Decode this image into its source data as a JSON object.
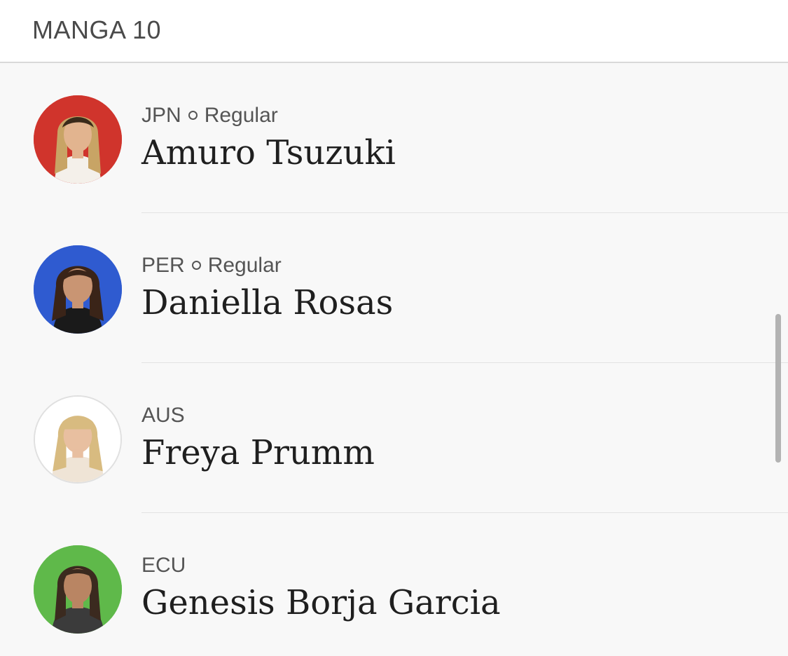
{
  "header": {
    "title": "MANGA 10"
  },
  "athletes": [
    {
      "country": "JPN",
      "stance": "Regular",
      "name": "Amuro Tsuzuki",
      "avatar_color": "#d0342c",
      "skin": "#e2b48f",
      "hair": "#c8a465"
    },
    {
      "country": "PER",
      "stance": "Regular",
      "name": "Daniella Rosas",
      "avatar_color": "#2f5bd0",
      "skin": "#c99573",
      "hair": "#3a2418"
    },
    {
      "country": "AUS",
      "stance": "",
      "name": "Freya Prumm",
      "avatar_color": "#ffffff",
      "skin": "#e8bfa0",
      "hair": "#d8bb80"
    },
    {
      "country": "ECU",
      "stance": "",
      "name": "Genesis Borja Garcia",
      "avatar_color": "#5fb94a",
      "skin": "#b98563",
      "hair": "#3b2a1f"
    }
  ]
}
